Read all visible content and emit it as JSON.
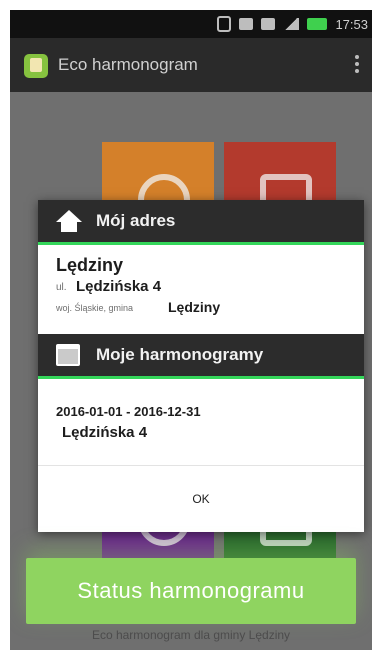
{
  "status_bar": {
    "time": "17:53"
  },
  "app_bar": {
    "title": "Eco harmonogram"
  },
  "dialog": {
    "address_header": "Mój adres",
    "city": "Lędziny",
    "street_prefix": "ul.",
    "street": "Lędzińska 4",
    "region": "woj. Śląskie, gmina",
    "municipality": "Lędziny",
    "schedules_header": "Moje harmonogramy",
    "schedule": {
      "date_range": "2016-01-01 - 2016-12-31",
      "address": "Lędzińska 4"
    },
    "ok_label": "OK"
  },
  "status_button": {
    "label": "Status harmonogramu"
  },
  "footer": {
    "text": "Eco harmonogram dla gminy Lędziny"
  },
  "icons": [
    "bluetooth-icon",
    "image-icon",
    "wifi-icon",
    "signal-icon",
    "battery-icon",
    "menu-icon",
    "home-icon",
    "calendar-icon"
  ],
  "colors": {
    "accent": "#34d65a",
    "status_button": "#8fd460",
    "dialog_header": "#2c2c2c"
  }
}
